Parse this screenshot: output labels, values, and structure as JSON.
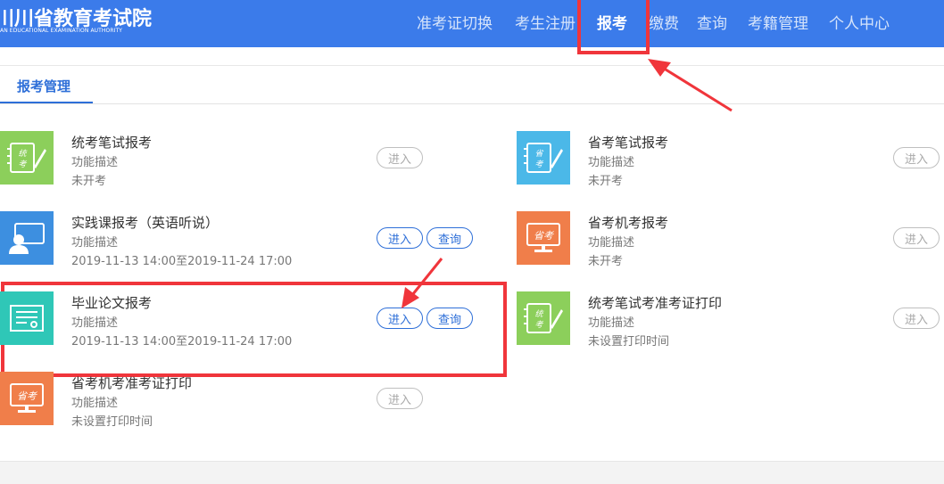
{
  "header": {
    "logo_cn": "川川省教育考试院",
    "logo_en": "AN EDUCATIONAL EXAMINATION AUTHORITY",
    "nav": [
      {
        "label": "准考证切换",
        "active": false
      },
      {
        "label": "考生注册",
        "active": false
      },
      {
        "label": "报考",
        "active": true
      },
      {
        "label": "缴费",
        "active": false
      },
      {
        "label": "查询",
        "active": false
      },
      {
        "label": "考籍管理",
        "active": false
      },
      {
        "label": "个人中心",
        "active": false
      }
    ]
  },
  "tabs": {
    "active_label": "报考管理"
  },
  "exams": [
    {
      "title": "统考笔试报考",
      "desc": "功能描述",
      "status": "未开考",
      "icon": "tong-kao-icon",
      "icon_color": "#8ccf5b",
      "enter_label": "进入",
      "enter_enabled": false,
      "query_label": ""
    },
    {
      "title": "省考笔试报考",
      "desc": "功能描述",
      "status": "未开考",
      "icon": "sheng-kao-icon",
      "icon_color": "#4bb8e8",
      "enter_label": "进入",
      "enter_enabled": false,
      "query_label": ""
    },
    {
      "title": "实践课报考（英语听说）",
      "desc": "功能描述",
      "status": "2019-11-13 14:00至2019-11-24 17:00",
      "icon": "teacher-board-icon",
      "icon_color": "#3d8fe0",
      "enter_label": "进入",
      "enter_enabled": true,
      "query_label": "查询"
    },
    {
      "title": "省考机考报考",
      "desc": "功能描述",
      "status": "未开考",
      "icon": "monitor-sheng-kao-icon",
      "icon_color": "#f07e4a",
      "enter_label": "进入",
      "enter_enabled": false,
      "query_label": ""
    },
    {
      "title": "毕业论文报考",
      "desc": "功能描述",
      "status": "2019-11-13 14:00至2019-11-24 17:00",
      "icon": "certificate-icon",
      "icon_color": "#2fc7b7",
      "enter_label": "进入",
      "enter_enabled": true,
      "query_label": "查询"
    },
    {
      "title": "统考笔试考准考证打印",
      "desc": "功能描述",
      "status": "未设置打印时间",
      "icon": "tong-kao-icon",
      "icon_color": "#8ccf5b",
      "enter_label": "进入",
      "enter_enabled": false,
      "query_label": ""
    },
    {
      "title": "省考机考准考证打印",
      "desc": "功能描述",
      "status": "未设置打印时间",
      "icon": "monitor-sheng-kao-icon",
      "icon_color": "#f07e4a",
      "enter_label": "进入",
      "enter_enabled": false,
      "query_label": ""
    }
  ],
  "colors": {
    "header_bg": "#3b7bea",
    "highlight": "#f0353b",
    "link": "#2e6fd8"
  }
}
